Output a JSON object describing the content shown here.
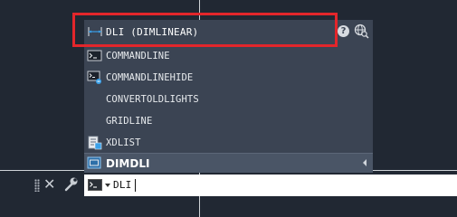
{
  "suggestions": {
    "top_match": {
      "label": "DLI (DIMLINEAR)",
      "icon": "dimlinear-icon"
    },
    "items": [
      {
        "label": "COMMANDLINE",
        "icon": "command-line-icon"
      },
      {
        "label": "COMMANDLINEHIDE",
        "icon": "command-line-hide-icon"
      },
      {
        "label": "CONVERTOLDLIGHTS",
        "icon": ""
      },
      {
        "label": "GRIDLINE",
        "icon": ""
      },
      {
        "label": "XDLIST",
        "icon": "xdlist-icon"
      }
    ],
    "category": {
      "label": "DIMDLI",
      "icon": "system-variable-icon"
    }
  },
  "command_line": {
    "value": "DLI"
  },
  "colors": {
    "highlight": "#e3262b",
    "popup_bg": "#3b4453",
    "canvas_bg": "#212833"
  }
}
